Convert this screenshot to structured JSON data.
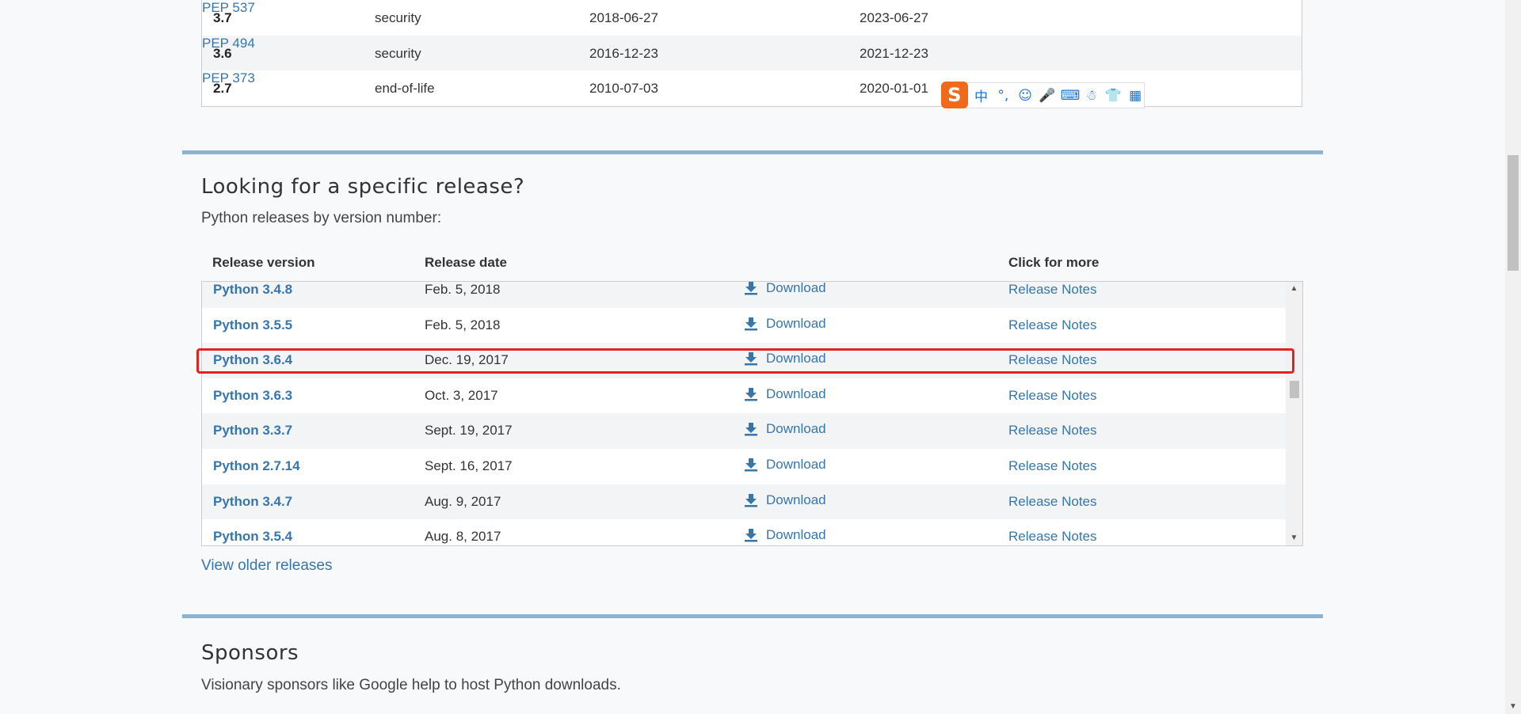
{
  "status_table": {
    "rows": [
      {
        "version": "3.7",
        "status": "security",
        "first_release": "2018-06-27",
        "end_of_support": "2023-06-27",
        "pep": "PEP 537"
      },
      {
        "version": "3.6",
        "status": "security",
        "first_release": "2016-12-23",
        "end_of_support": "2021-12-23",
        "pep": "PEP 494"
      },
      {
        "version": "2.7",
        "status": "end-of-life",
        "first_release": "2010-07-03",
        "end_of_support": "2020-01-01",
        "pep": "PEP 373"
      }
    ]
  },
  "releases_section": {
    "title": "Looking for a specific release?",
    "subtitle": "Python releases by version number:",
    "headers": {
      "version": "Release version",
      "date": "Release date",
      "more": "Click for more"
    },
    "rows": [
      {
        "version": "Python 3.4.8",
        "date": "Feb. 5, 2018",
        "download": "Download",
        "notes": "Release Notes"
      },
      {
        "version": "Python 3.5.5",
        "date": "Feb. 5, 2018",
        "download": "Download",
        "notes": "Release Notes"
      },
      {
        "version": "Python 3.6.4",
        "date": "Dec. 19, 2017",
        "download": "Download",
        "notes": "Release Notes"
      },
      {
        "version": "Python 3.6.3",
        "date": "Oct. 3, 2017",
        "download": "Download",
        "notes": "Release Notes"
      },
      {
        "version": "Python 3.3.7",
        "date": "Sept. 19, 2017",
        "download": "Download",
        "notes": "Release Notes"
      },
      {
        "version": "Python 2.7.14",
        "date": "Sept. 16, 2017",
        "download": "Download",
        "notes": "Release Notes"
      },
      {
        "version": "Python 3.4.7",
        "date": "Aug. 9, 2017",
        "download": "Download",
        "notes": "Release Notes"
      },
      {
        "version": "Python 3.5.4",
        "date": "Aug. 8, 2017",
        "download": "Download",
        "notes": "Release Notes"
      }
    ],
    "older_link": "View older releases"
  },
  "sponsors_section": {
    "title": "Sponsors",
    "subtitle": "Visionary sponsors like Google help to host Python downloads."
  },
  "ime_toolbar": {
    "logo": "S",
    "items": [
      "中",
      "°,",
      "☺",
      "🎤",
      "⌨",
      "☃",
      "👕",
      "▦"
    ]
  },
  "colors": {
    "link": "#3776ab",
    "rule": "#8cb4d2",
    "highlight": "#e52222",
    "ime_logo": "#f06a1c"
  }
}
